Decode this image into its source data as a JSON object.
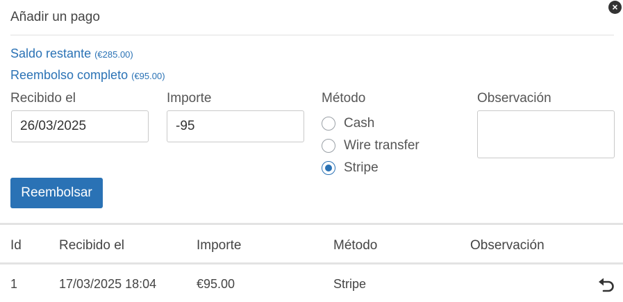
{
  "modal": {
    "title": "Añadir un pago",
    "close_icon": "close-icon",
    "remaining_balance": {
      "label": "Saldo restante",
      "amount": "(€285.00)"
    },
    "full_refund": {
      "label": "Reembolso completo",
      "amount": "(€95.00)"
    }
  },
  "form": {
    "received_label": "Recibido el",
    "received_value": "26/03/2025",
    "amount_label": "Importe",
    "amount_value": "-95",
    "method_label": "Método",
    "methods": [
      {
        "label": "Cash",
        "checked": false
      },
      {
        "label": "Wire transfer",
        "checked": false
      },
      {
        "label": "Stripe",
        "checked": true
      }
    ],
    "note_label": "Observación",
    "note_value": "",
    "submit_label": "Reembolsar"
  },
  "table": {
    "headers": [
      "Id",
      "Recibido el",
      "Importe",
      "Método",
      "Observación"
    ],
    "rows": [
      {
        "id": "1",
        "received": "17/03/2025 18:04",
        "amount": "€95.00",
        "method": "Stripe",
        "note": "",
        "action_icon": "undo-icon"
      }
    ]
  },
  "colors": {
    "accent": "#2a72b5"
  }
}
